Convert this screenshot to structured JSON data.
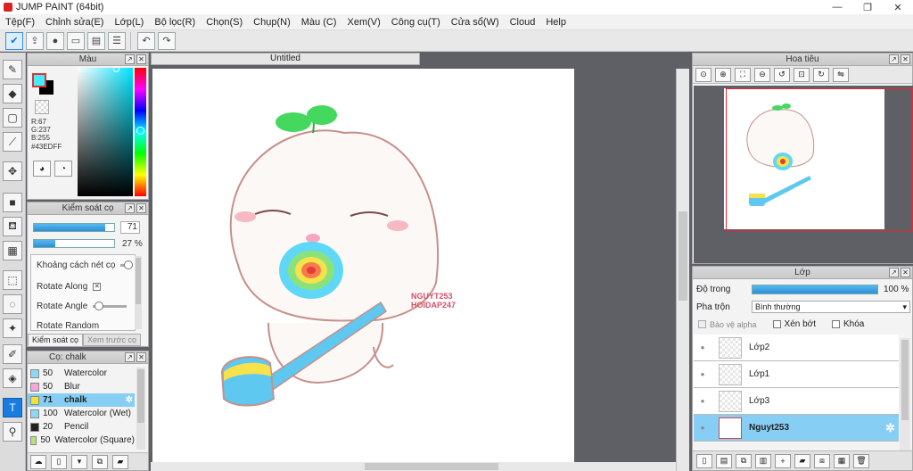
{
  "window": {
    "title": "JUMP PAINT (64bit)",
    "min": "—",
    "max": "❐",
    "close": "✕"
  },
  "menu": [
    "Tệp(F)",
    "Chỉnh sửa(E)",
    "Lớp(L)",
    "Bộ lọc(R)",
    "Chọn(S)",
    "Chụp(N)",
    "Màu (C)",
    "Xem(V)",
    "Công cụ(T)",
    "Cửa sổ(W)",
    "Cloud",
    "Help"
  ],
  "toolbar": {
    "undo": "↶",
    "redo": "↷"
  },
  "color_panel": {
    "title": "Màu",
    "fg_color": "#43EDFF",
    "rgb": {
      "r": "R:67",
      "g": "G:237",
      "b": "B:255"
    },
    "hex": "#43EDFF"
  },
  "brush_control": {
    "title": "Kiểm soát cọ",
    "size_value": "71",
    "opacity_value": "27 %",
    "size_fill": 0.89,
    "opacity_fill": 0.27,
    "options": [
      "Khoảng cách nét cọ",
      "Rotate Along",
      "Rotate Angle",
      "Rotate Random"
    ],
    "tabs": [
      "Kiểm soát cọ",
      "Xem trước cọ"
    ]
  },
  "brush_list": {
    "title": "Cọ: chalk",
    "items": [
      {
        "size": "50",
        "name": "Watercolor",
        "color": "#8fd8f5"
      },
      {
        "size": "50",
        "name": "Blur",
        "color": "#f6a6d8"
      },
      {
        "size": "71",
        "name": "chalk",
        "color": "#f2e233",
        "selected": true
      },
      {
        "size": "100",
        "name": "Watercolor (Wet)",
        "color": "#8fd8f5"
      },
      {
        "size": "20",
        "name": "Pencil",
        "color": "#222222"
      },
      {
        "size": "50",
        "name": "Watercolor (Square)",
        "color": "#b8e37a"
      }
    ]
  },
  "canvas": {
    "tab_title": "Untitled",
    "watermark_line1": "NGUYT253",
    "watermark_line2": "HOIDAP247"
  },
  "navigator": {
    "title": "Hoa tiêu"
  },
  "layers": {
    "title": "Lớp",
    "opacity_label": "Độ trong",
    "opacity_value": "100 %",
    "blend_label": "Pha trộn",
    "blend_value": "Bình thường",
    "protect_alpha": "Bảo vệ alpha",
    "clip": "Xén bớt",
    "lock": "Khóa",
    "items": [
      {
        "name": "Lớp2",
        "selected": false
      },
      {
        "name": "Lớp1",
        "selected": false
      },
      {
        "name": "Lớp3",
        "selected": false
      },
      {
        "name": "Nguyt253",
        "selected": true
      }
    ]
  }
}
